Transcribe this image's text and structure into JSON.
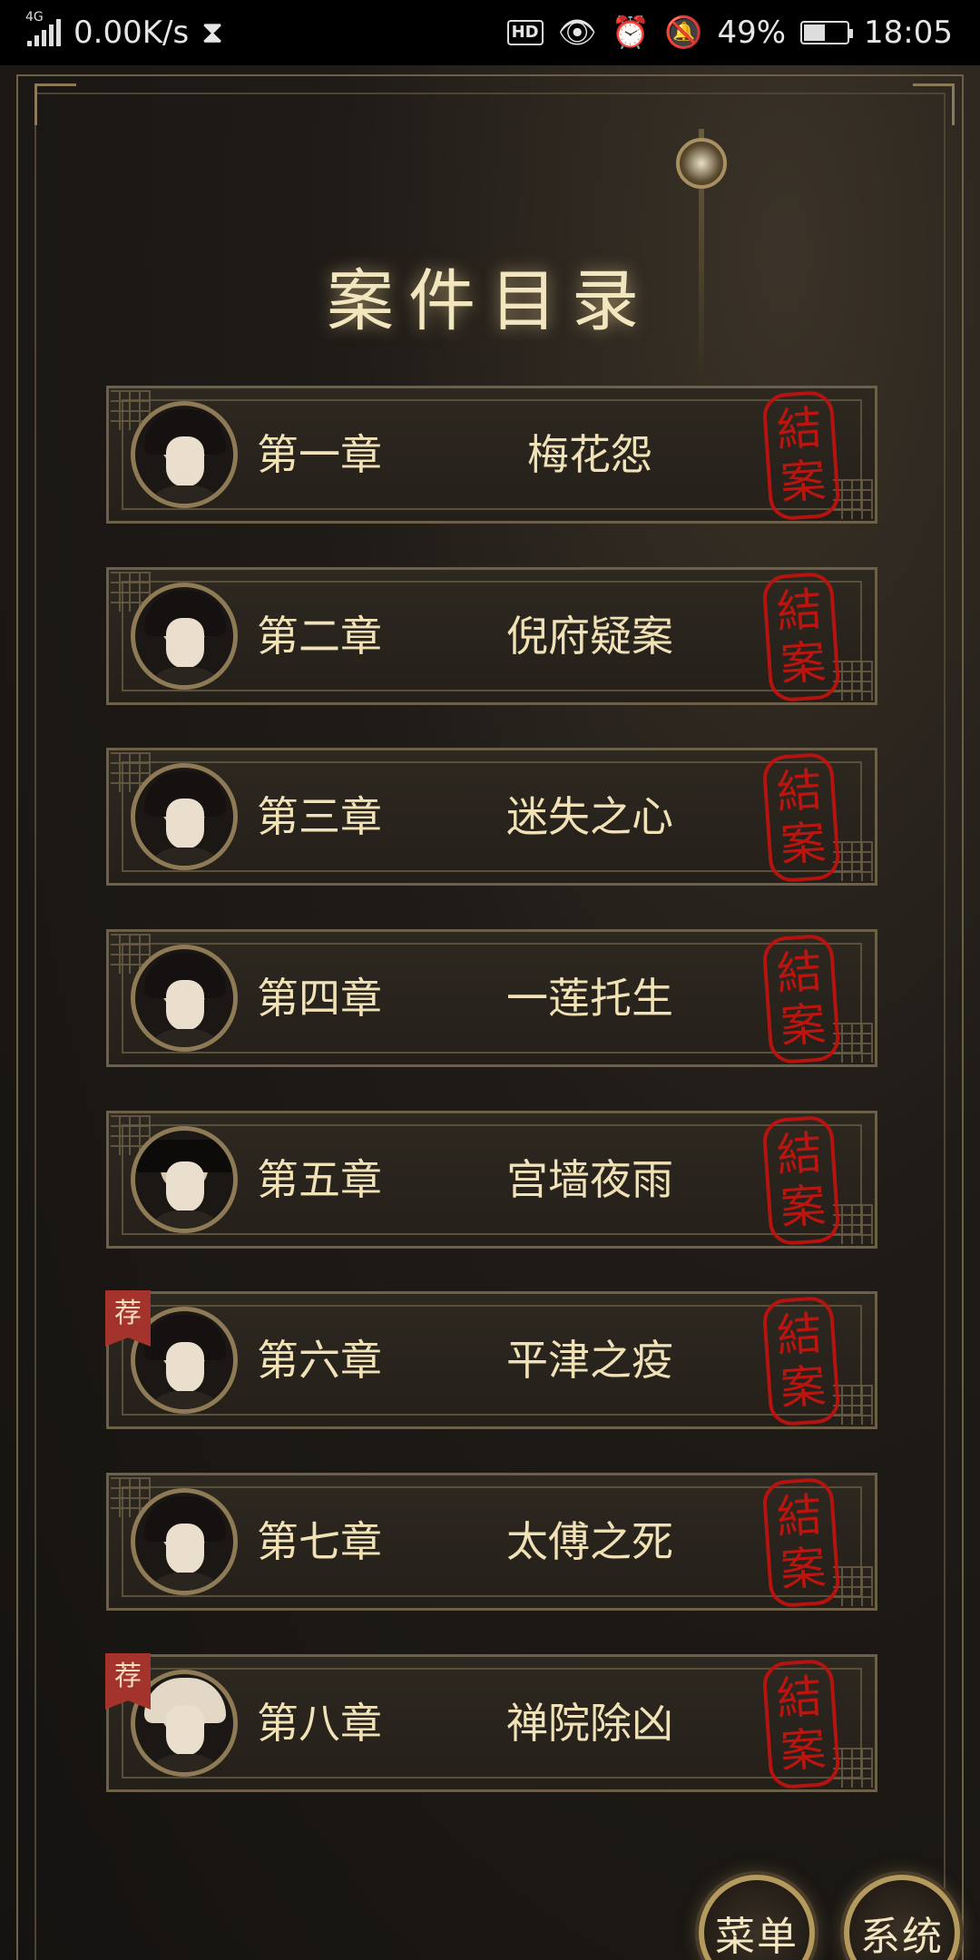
{
  "status_bar": {
    "network_type": "4G",
    "speed": "0.00K/s",
    "hd": "HD",
    "battery": "49%",
    "battery_level": 0.49,
    "time": "18:05"
  },
  "page": {
    "title": "案件目录"
  },
  "chapters": [
    {
      "num": "第一章",
      "name": "梅花怨",
      "seal": [
        "結",
        "案"
      ],
      "recommended": false,
      "avatar": "avatar-long-hair"
    },
    {
      "num": "第二章",
      "name": "倪府疑案",
      "seal": [
        "結",
        "案"
      ],
      "recommended": false,
      "avatar": "avatar-elder-beard"
    },
    {
      "num": "第三章",
      "name": "迷失之心",
      "seal": [
        "結",
        "案"
      ],
      "recommended": false,
      "avatar": "avatar-young-man"
    },
    {
      "num": "第四章",
      "name": "一莲托生",
      "seal": [
        "結",
        "案"
      ],
      "recommended": false,
      "avatar": "avatar-woman"
    },
    {
      "num": "第五章",
      "name": "宫墙夜雨",
      "seal": [
        "結",
        "案"
      ],
      "recommended": false,
      "avatar": "avatar-official-hat"
    },
    {
      "num": "第六章",
      "name": "平津之疫",
      "seal": [
        "結",
        "案"
      ],
      "recommended": true,
      "badge": "荐",
      "avatar": "avatar-youth"
    },
    {
      "num": "第七章",
      "name": "太傅之死",
      "seal": [
        "結",
        "案"
      ],
      "recommended": false,
      "avatar": "avatar-scholar"
    },
    {
      "num": "第八章",
      "name": "禅院除凶",
      "seal": [
        "結",
        "案"
      ],
      "recommended": true,
      "badge": "荐",
      "avatar": "avatar-monk"
    }
  ],
  "buttons": {
    "menu": "菜单",
    "system": "系统"
  },
  "colors": {
    "gold_text": "#f1e1b6",
    "seal_red": "#c8140f",
    "frame_gold": "#6d6048",
    "badge_red": "#a3332b"
  }
}
